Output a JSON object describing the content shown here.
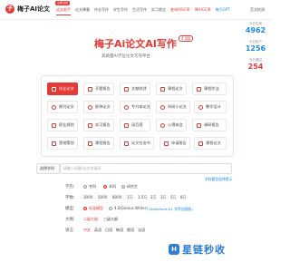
{
  "header": {
    "logo_mark": "子",
    "logo_text": "梅子AI论文",
    "nav": [
      {
        "label": "论文助手",
        "state": "active",
        "badge": "立即试用"
      },
      {
        "label": "论文降重",
        "state": "normal",
        "badge": ""
      },
      {
        "label": "作业写作",
        "state": "normal",
        "badge": ""
      },
      {
        "label": "学生写作",
        "state": "normal",
        "badge": ""
      },
      {
        "label": "生活写作",
        "state": "normal",
        "badge": ""
      },
      {
        "label": "实习就业",
        "state": "normal",
        "badge": ""
      },
      {
        "label": "查询AIGC率",
        "state": "red",
        "badge": ""
      },
      {
        "label": "降AIGC率",
        "state": "red",
        "badge": ""
      },
      {
        "label": "梅子GPT",
        "state": "blue",
        "badge": ""
      }
    ],
    "right_link": "范文检测"
  },
  "hero": {
    "title": "梅子Ai论文AI写作",
    "version": "4.0版",
    "subtitle": "高质量AI学位论文写作平台"
  },
  "tools": [
    {
      "label": "毕业论文",
      "active": true
    },
    {
      "label": "开题报告",
      "active": false
    },
    {
      "label": "文献综述",
      "active": false
    },
    {
      "label": "课程论文",
      "active": false
    },
    {
      "label": "课程作业",
      "active": false
    },
    {
      "label": "期刊论文",
      "active": false
    },
    {
      "label": "职称论文",
      "active": false
    },
    {
      "label": "专升本论文",
      "active": false
    },
    {
      "label": "科研小论文",
      "active": false
    },
    {
      "label": "教学设计",
      "active": false
    },
    {
      "label": "职业规划",
      "active": false
    },
    {
      "label": "实习报告",
      "active": false
    },
    {
      "label": "读后感",
      "active": false
    },
    {
      "label": "心得体会",
      "active": false
    },
    {
      "label": "调研报告",
      "active": false
    },
    {
      "label": "营销策划",
      "active": false
    },
    {
      "label": "课程报告",
      "active": false
    },
    {
      "label": "论文任务书",
      "active": false
    },
    {
      "label": "申请报告",
      "active": false
    },
    {
      "label": "课程论文",
      "active": false
    },
    {
      "label": "毕业论文写作",
      "active": false
    }
  ],
  "side_stats": [
    {
      "label": "今日生成",
      "value": "4962",
      "color": "#1e88e5"
    },
    {
      "label": "今日用户",
      "value": "1256",
      "color": "#1e88e5"
    },
    {
      "label": "今日通过",
      "value": "254",
      "color": "#e53935"
    }
  ],
  "form": {
    "select_label": "选择学科",
    "topic_placeholder": "请输入标题/论文关键词",
    "helper_link": "学科题目选择提示",
    "degree_label": "学历:",
    "degree_options": [
      {
        "label": "专科",
        "selected": false
      },
      {
        "label": "本科",
        "selected": true
      },
      {
        "label": "研究生",
        "selected": false
      }
    ],
    "words_label": "字数:",
    "word_options": [
      "3000",
      "5000",
      "8000",
      "1万",
      "1.5万",
      "2万",
      "3万",
      "5万",
      "8万"
    ],
    "model_label": "模型:",
    "model_options": [
      {
        "label": "标准模型",
        "selected": true
      },
      {
        "label": "4.0(Genius Writer)",
        "selected": false
      }
    ],
    "model_note": "(DeepSeek R1 学术加强版)",
    "outline_label": "大纲:",
    "outline_options": [
      "二级大纲",
      "三级大纲"
    ],
    "lang_label": "语言:",
    "lang_options": [
      "中文",
      "英语",
      "日语",
      "韩语",
      "俄语",
      "法语"
    ]
  },
  "watermark": {
    "badge": "H",
    "text": "星链秒收"
  },
  "colors": {
    "brand": "#e53935",
    "link": "#1e88e5"
  }
}
